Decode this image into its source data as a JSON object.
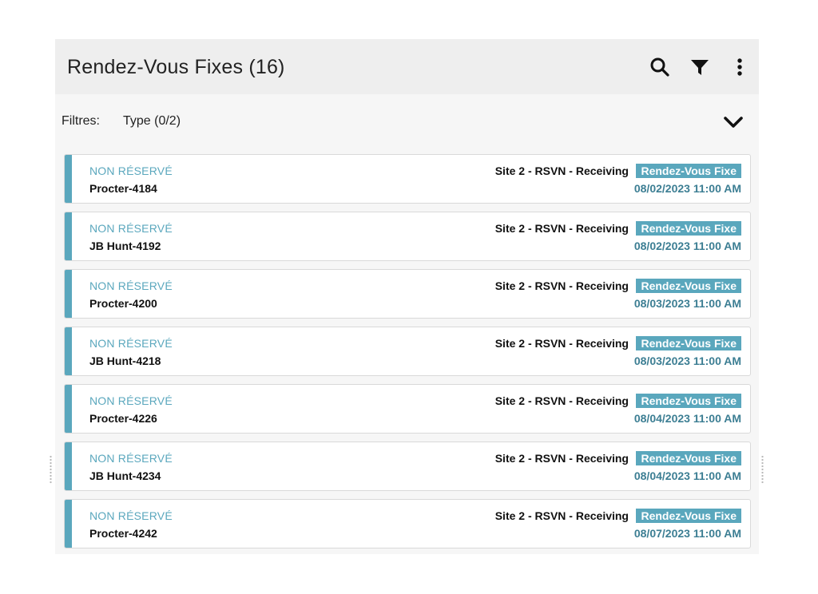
{
  "header": {
    "title": "Rendez-Vous Fixes (16)",
    "icons": [
      "search-icon",
      "filter-icon",
      "more-vert-icon"
    ]
  },
  "filters": {
    "label": "Filtres:",
    "type_label": "Type (0/2)",
    "toggle_icon": "chevron-down-icon"
  },
  "appointments": [
    {
      "status": "NON RÉSERVÉ",
      "name": "Procter-4184",
      "site": "Site 2 - RSVN - Receiving",
      "badge": "Rendez-Vous Fixe",
      "date": "08/02/2023 11:00 AM"
    },
    {
      "status": "NON RÉSERVÉ",
      "name": "JB Hunt-4192",
      "site": "Site 2 - RSVN - Receiving",
      "badge": "Rendez-Vous Fixe",
      "date": "08/02/2023 11:00 AM"
    },
    {
      "status": "NON RÉSERVÉ",
      "name": "Procter-4200",
      "site": "Site 2 - RSVN - Receiving",
      "badge": "Rendez-Vous Fixe",
      "date": "08/03/2023 11:00 AM"
    },
    {
      "status": "NON RÉSERVÉ",
      "name": "JB Hunt-4218",
      "site": "Site 2 - RSVN - Receiving",
      "badge": "Rendez-Vous Fixe",
      "date": "08/03/2023 11:00 AM"
    },
    {
      "status": "NON RÉSERVÉ",
      "name": "Procter-4226",
      "site": "Site 2 - RSVN - Receiving",
      "badge": "Rendez-Vous Fixe",
      "date": "08/04/2023 11:00 AM"
    },
    {
      "status": "NON RÉSERVÉ",
      "name": "JB Hunt-4234",
      "site": "Site 2 - RSVN - Receiving",
      "badge": "Rendez-Vous Fixe",
      "date": "08/04/2023 11:00 AM"
    },
    {
      "status": "NON RÉSERVÉ",
      "name": "Procter-4242",
      "site": "Site 2 - RSVN - Receiving",
      "badge": "Rendez-Vous Fixe",
      "date": "08/07/2023 11:00 AM"
    }
  ],
  "colors": {
    "accent": "#5aa7bd",
    "date_text": "#3c7e93",
    "header_bg": "#eeeeee"
  }
}
